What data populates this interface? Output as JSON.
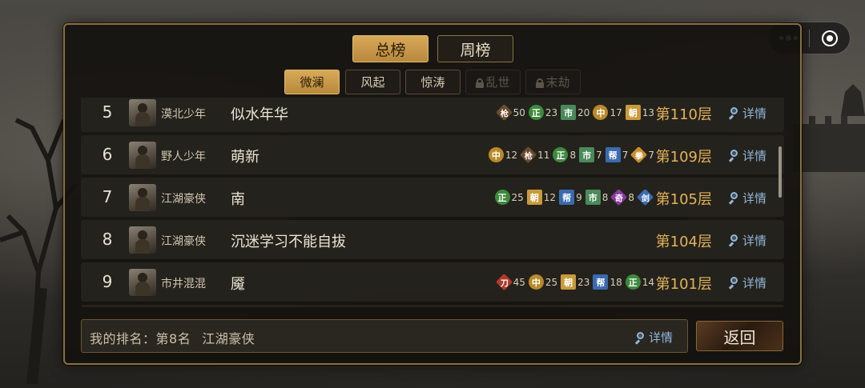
{
  "main_tabs": [
    {
      "label": "总榜",
      "active": true
    },
    {
      "label": "周榜",
      "active": false
    }
  ],
  "sub_tabs": [
    {
      "label": "微澜",
      "state": "active"
    },
    {
      "label": "风起",
      "state": "normal"
    },
    {
      "label": "惊涛",
      "state": "normal"
    },
    {
      "label": "乱世",
      "state": "locked"
    },
    {
      "label": "末劫",
      "state": "locked"
    }
  ],
  "rows": [
    {
      "rank": "5",
      "title": "漠北少年",
      "name": "似水年华",
      "floor": "第110层",
      "detail": "详情",
      "badges": [
        {
          "icon": "枪",
          "shape": "dia",
          "color": "#6b4a2e",
          "value": "50"
        },
        {
          "icon": "正",
          "shape": "round",
          "color": "#3d8a3d",
          "value": "23"
        },
        {
          "icon": "市",
          "shape": "sq",
          "color": "#4a8a5a",
          "value": "20"
        },
        {
          "icon": "中",
          "shape": "round",
          "color": "#b88a2a",
          "value": "17"
        },
        {
          "icon": "朝",
          "shape": "sq",
          "color": "#c89a3a",
          "value": "13"
        }
      ]
    },
    {
      "rank": "6",
      "title": "野人少年",
      "name": "萌新",
      "floor": "第109层",
      "detail": "详情",
      "badges": [
        {
          "icon": "中",
          "shape": "round",
          "color": "#b88a2a",
          "value": "12"
        },
        {
          "icon": "枪",
          "shape": "dia",
          "color": "#6b4a2e",
          "value": "11"
        },
        {
          "icon": "正",
          "shape": "round",
          "color": "#3d8a3d",
          "value": "8"
        },
        {
          "icon": "市",
          "shape": "sq",
          "color": "#4a8a5a",
          "value": "7"
        },
        {
          "icon": "帮",
          "shape": "sq",
          "color": "#3a6ab0",
          "value": "7"
        },
        {
          "icon": "拳",
          "shape": "dia",
          "color": "#c8902a",
          "value": "7"
        }
      ]
    },
    {
      "rank": "7",
      "title": "江湖豪侠",
      "name": "南",
      "floor": "第105层",
      "detail": "详情",
      "badges": [
        {
          "icon": "正",
          "shape": "round",
          "color": "#3d8a3d",
          "value": "25"
        },
        {
          "icon": "朝",
          "shape": "sq",
          "color": "#c89a3a",
          "value": "12"
        },
        {
          "icon": "帮",
          "shape": "sq",
          "color": "#3a6ab0",
          "value": "9"
        },
        {
          "icon": "市",
          "shape": "sq",
          "color": "#4a8a5a",
          "value": "8"
        },
        {
          "icon": "奇",
          "shape": "dia",
          "color": "#8a3aa0",
          "value": "8"
        },
        {
          "icon": "剑",
          "shape": "dia",
          "color": "#3a6ab0",
          "value": ""
        }
      ]
    },
    {
      "rank": "8",
      "title": "江湖豪侠",
      "name": "沉迷学习不能自拔",
      "floor": "第104层",
      "detail": "详情",
      "badges": []
    },
    {
      "rank": "9",
      "title": "市井混混",
      "name": "魇",
      "floor": "第101层",
      "detail": "详情",
      "badges": [
        {
          "icon": "刀",
          "shape": "dia",
          "color": "#b03a2a",
          "value": "45"
        },
        {
          "icon": "中",
          "shape": "round",
          "color": "#b88a2a",
          "value": "25"
        },
        {
          "icon": "朝",
          "shape": "sq",
          "color": "#c89a3a",
          "value": "23"
        },
        {
          "icon": "帮",
          "shape": "sq",
          "color": "#3a6ab0",
          "value": "18"
        },
        {
          "icon": "正",
          "shape": "round",
          "color": "#3d8a3d",
          "value": "14"
        }
      ]
    }
  ],
  "my_rank": {
    "label": "我的排名：",
    "rank": "第8名",
    "title": "江湖豪侠",
    "detail": "详情"
  },
  "back_button": "返回",
  "colors": {
    "accent_gold": "#d7a959",
    "floor_text": "#e3b25a",
    "detail_link": "#8fb6d9"
  }
}
